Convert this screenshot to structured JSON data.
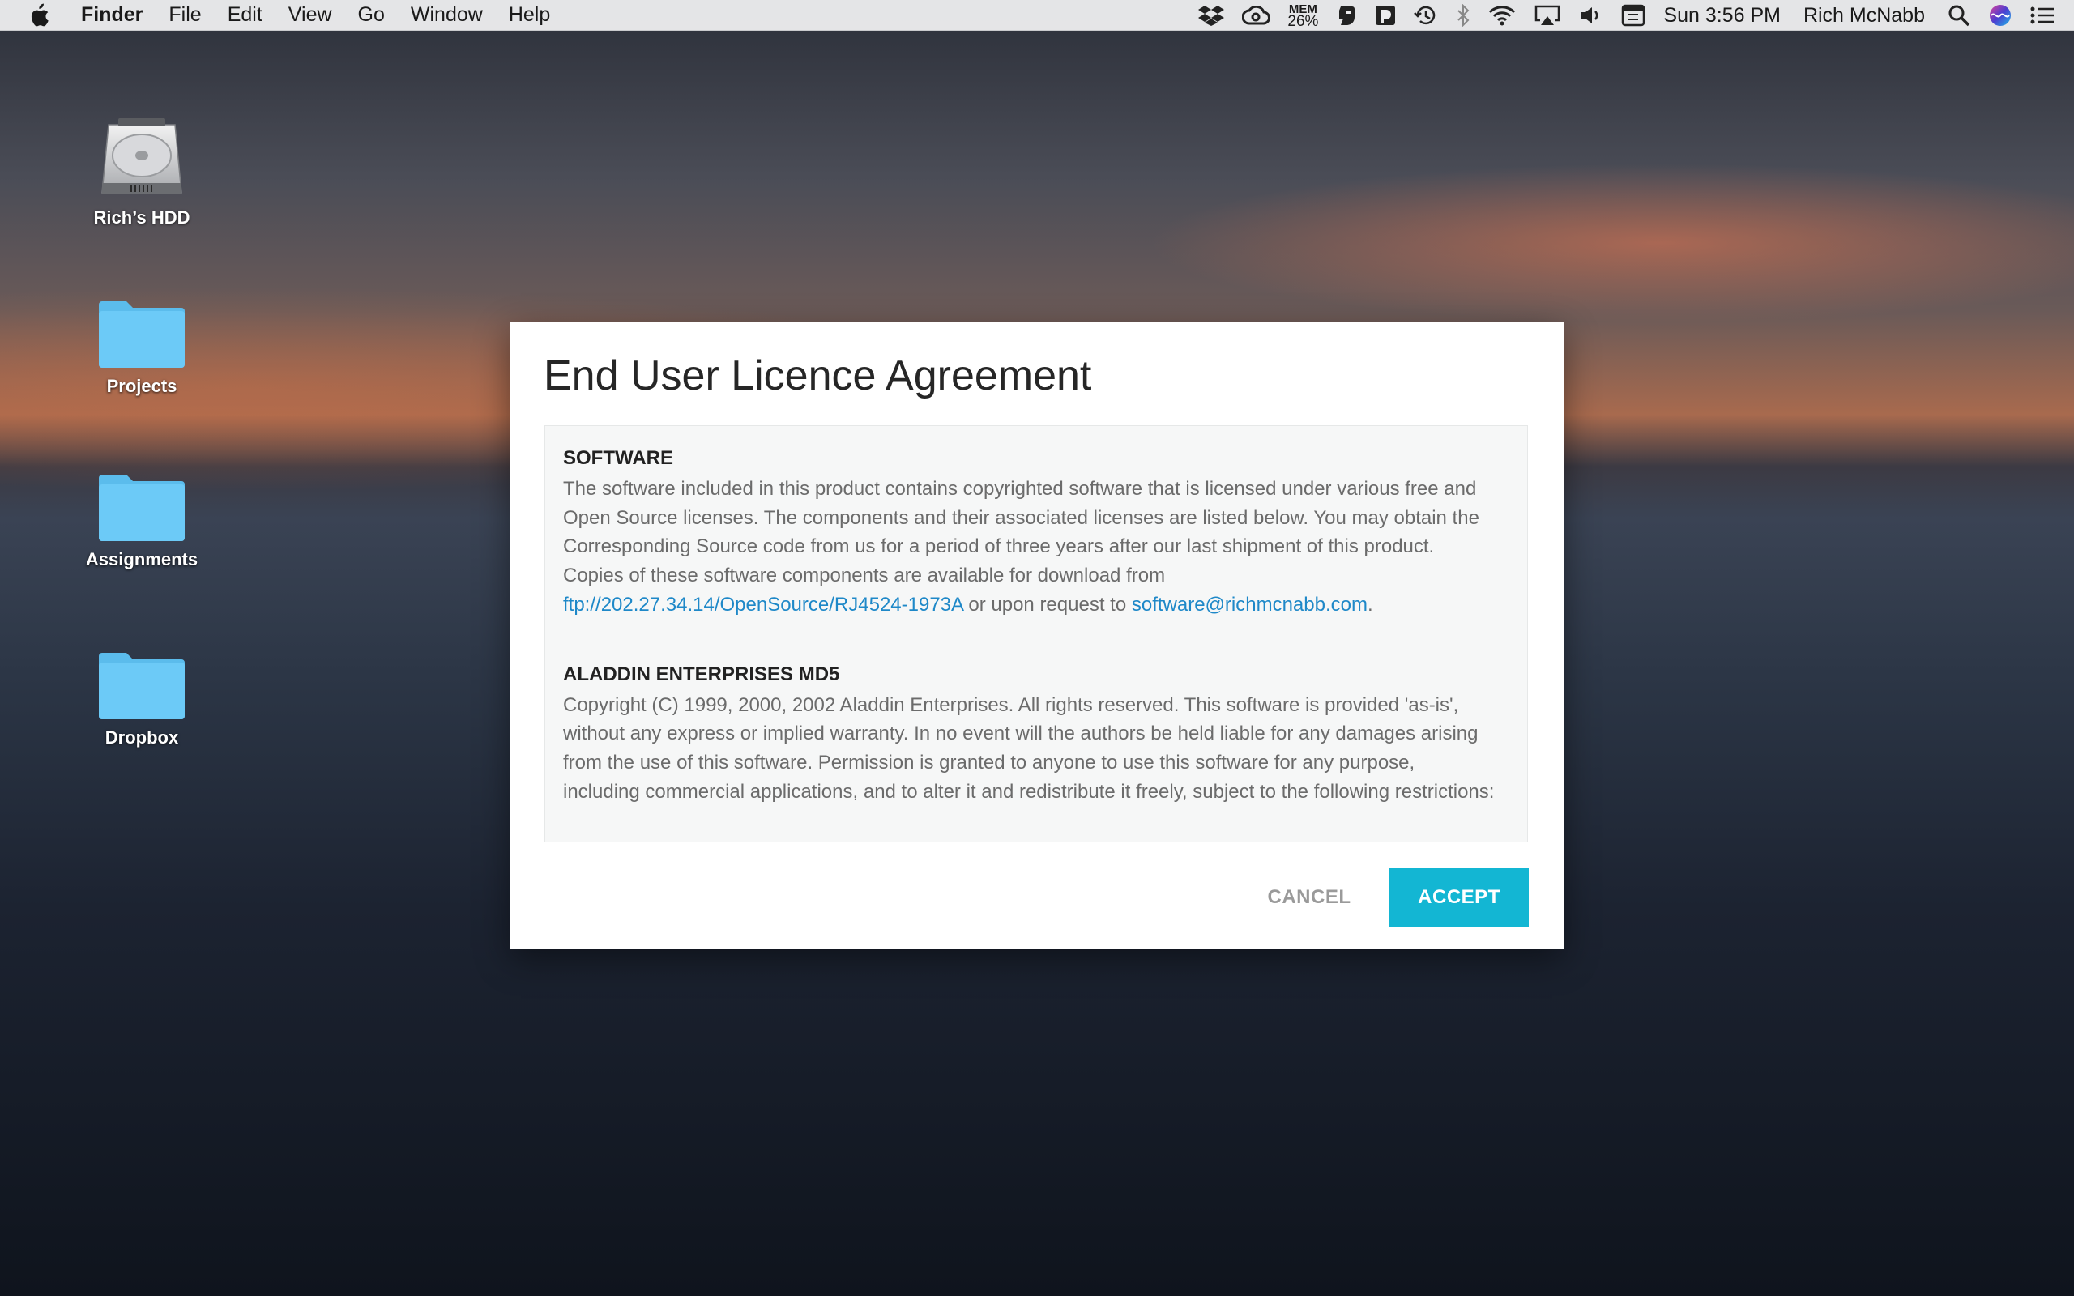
{
  "menubar": {
    "app_name": "Finder",
    "menus": [
      "File",
      "Edit",
      "View",
      "Go",
      "Window",
      "Help"
    ],
    "mem_label": "MEM",
    "mem_value": "26%",
    "clock": "Sun 3:56 PM",
    "user": "Rich McNabb",
    "tray_icons": [
      "dropbox-icon",
      "creative-cloud-icon",
      "memory-monitor-icon",
      "evernote-icon",
      "bartender-icon",
      "time-machine-icon",
      "bluetooth-icon",
      "wifi-icon",
      "airplay-icon",
      "volume-icon",
      "keyboard-input-icon",
      "spotlight-search-icon",
      "siri-icon",
      "notification-center-icon"
    ]
  },
  "desktop": {
    "icons": [
      {
        "label": "Rich’s HDD",
        "icon": "hard-drive-icon"
      },
      {
        "label": "Projects",
        "icon": "folder-icon"
      },
      {
        "label": "Assignments",
        "icon": "folder-icon"
      },
      {
        "label": "Dropbox",
        "icon": "folder-icon"
      }
    ]
  },
  "dialog": {
    "title": "End User Licence Agreement",
    "sections": [
      {
        "title": "SOFTWARE",
        "text_1": "The software included in this product contains copyrighted software that is licensed under various free and Open Source licenses. The components and their associated licenses are listed below. You may obtain the Corresponding Source code from us for a period of three years after our last shipment of this product. Copies of these software components are available for download from ",
        "link_1": "ftp://202.27.34.14/OpenSource/RJ4524-1973A",
        "text_2": " or upon request to ",
        "link_2": "software@richmcnabb.com",
        "text_3": "."
      },
      {
        "title": "ALADDIN ENTERPRISES MD5",
        "text": "Copyright (C) 1999, 2000, 2002 Aladdin Enterprises. All rights reserved. This software is provided 'as-is', without any express or implied warranty. In no event will the authors be held liable for any damages arising from the use of this software. Permission is granted to anyone to use this software for any purpose, including commercial applications, and to alter it and redistribute it freely, subject to the following restrictions:"
      }
    ],
    "cancel_label": "CANCEL",
    "accept_label": "ACCEPT"
  },
  "colors": {
    "accent": "#13b6d3",
    "link": "#1e88c8",
    "folder": "#6ccaf7"
  }
}
